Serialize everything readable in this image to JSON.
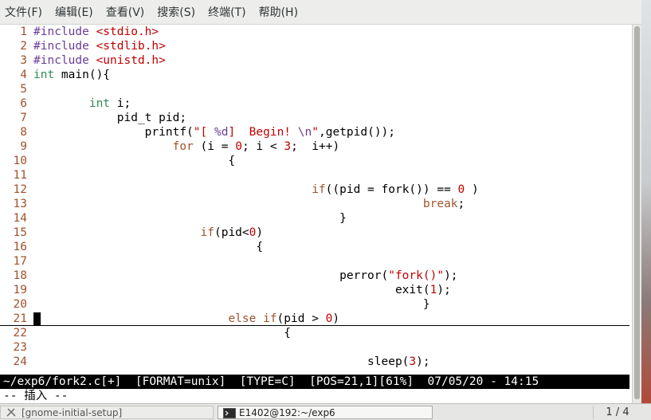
{
  "menu": [
    "文件(F)",
    "编辑(E)",
    "查看(V)",
    "搜索(S)",
    "终端(T)",
    "帮助(H)"
  ],
  "code_lines": [
    {
      "n": "1",
      "segments": [
        {
          "t": "#include ",
          "c": "pre"
        },
        {
          "t": "<stdio.h>",
          "c": "str"
        }
      ]
    },
    {
      "n": "2",
      "segments": [
        {
          "t": "#include ",
          "c": "pre"
        },
        {
          "t": "<stdlib.h>",
          "c": "str"
        }
      ]
    },
    {
      "n": "3",
      "segments": [
        {
          "t": "#include ",
          "c": "pre"
        },
        {
          "t": "<unistd.h>",
          "c": "str"
        }
      ]
    },
    {
      "n": "4",
      "segments": [
        {
          "t": "int",
          "c": "type"
        },
        {
          "t": " main(){",
          "c": "txt"
        }
      ]
    },
    {
      "n": "5",
      "segments": []
    },
    {
      "n": "6",
      "segments": [
        {
          "t": "        ",
          "c": "txt"
        },
        {
          "t": "int",
          "c": "type"
        },
        {
          "t": " i;",
          "c": "txt"
        }
      ]
    },
    {
      "n": "7",
      "segments": [
        {
          "t": "            pid_t pid;",
          "c": "txt"
        }
      ]
    },
    {
      "n": "8",
      "segments": [
        {
          "t": "                printf(",
          "c": "txt"
        },
        {
          "t": "\"[ ",
          "c": "str"
        },
        {
          "t": "%d",
          "c": "pre"
        },
        {
          "t": "]  Begin! ",
          "c": "str"
        },
        {
          "t": "\\n",
          "c": "pre"
        },
        {
          "t": "\"",
          "c": "str"
        },
        {
          "t": ",getpid());",
          "c": "txt"
        }
      ]
    },
    {
      "n": "9",
      "segments": [
        {
          "t": "                    ",
          "c": "txt"
        },
        {
          "t": "for",
          "c": "kw"
        },
        {
          "t": " (i = ",
          "c": "txt"
        },
        {
          "t": "0",
          "c": "num"
        },
        {
          "t": "; i < ",
          "c": "txt"
        },
        {
          "t": "3",
          "c": "num"
        },
        {
          "t": ";  i++)",
          "c": "txt"
        }
      ]
    },
    {
      "n": "10",
      "segments": [
        {
          "t": "                            {",
          "c": "txt"
        }
      ]
    },
    {
      "n": "11",
      "segments": []
    },
    {
      "n": "12",
      "segments": [
        {
          "t": "                                        ",
          "c": "txt"
        },
        {
          "t": "if",
          "c": "kw"
        },
        {
          "t": "((pid = fork()) == ",
          "c": "txt"
        },
        {
          "t": "0",
          "c": "num"
        },
        {
          "t": " )",
          "c": "txt"
        }
      ]
    },
    {
      "n": "13",
      "segments": [
        {
          "t": "                                                        ",
          "c": "txt"
        },
        {
          "t": "break",
          "c": "kw"
        },
        {
          "t": ";",
          "c": "txt"
        }
      ]
    },
    {
      "n": "14",
      "segments": [
        {
          "t": "                                            }",
          "c": "txt"
        }
      ]
    },
    {
      "n": "15",
      "segments": [
        {
          "t": "                        ",
          "c": "txt"
        },
        {
          "t": "if",
          "c": "kw"
        },
        {
          "t": "(pid<",
          "c": "txt"
        },
        {
          "t": "0",
          "c": "num"
        },
        {
          "t": ")",
          "c": "txt"
        }
      ]
    },
    {
      "n": "16",
      "segments": [
        {
          "t": "                                {",
          "c": "txt"
        }
      ]
    },
    {
      "n": "17",
      "segments": []
    },
    {
      "n": "18",
      "segments": [
        {
          "t": "                                            perror(",
          "c": "txt"
        },
        {
          "t": "\"fork()\"",
          "c": "str"
        },
        {
          "t": ");",
          "c": "txt"
        }
      ]
    },
    {
      "n": "19",
      "segments": [
        {
          "t": "                                                    exit(",
          "c": "txt"
        },
        {
          "t": "1",
          "c": "num"
        },
        {
          "t": ");",
          "c": "txt"
        }
      ]
    },
    {
      "n": "20",
      "segments": [
        {
          "t": "                                                        }",
          "c": "txt"
        }
      ]
    },
    {
      "n": "21",
      "segments": [
        {
          "t": "                            ",
          "c": "txt"
        },
        {
          "t": "else if",
          "c": "kw"
        },
        {
          "t": "(pid > ",
          "c": "txt"
        },
        {
          "t": "0",
          "c": "num"
        },
        {
          "t": ")",
          "c": "txt"
        }
      ]
    },
    {
      "n": "22",
      "segments": [
        {
          "t": "                                    {",
          "c": "txt"
        }
      ]
    },
    {
      "n": "23",
      "segments": []
    },
    {
      "n": "24",
      "segments": [
        {
          "t": "                                                sleep(",
          "c": "txt"
        },
        {
          "t": "3",
          "c": "num"
        },
        {
          "t": ");",
          "c": "txt"
        }
      ]
    }
  ],
  "status_line": "~/exp6/fork2.c[+]  [FORMAT=unix]  [TYPE=C]  [POS=21,1][61%]  07/05/20 - 14:15",
  "mode_line": "-- 插入 --",
  "taskbar": {
    "task1": "[gnome-initial-setup]",
    "task2": "E1402@192:~/exp6",
    "pager": "1 / 4"
  },
  "colors": {
    "pre": "#6a3d9a",
    "str": "#c00000",
    "type": "#2e8b57",
    "kw": "#a0522d",
    "num": "#c00000"
  }
}
